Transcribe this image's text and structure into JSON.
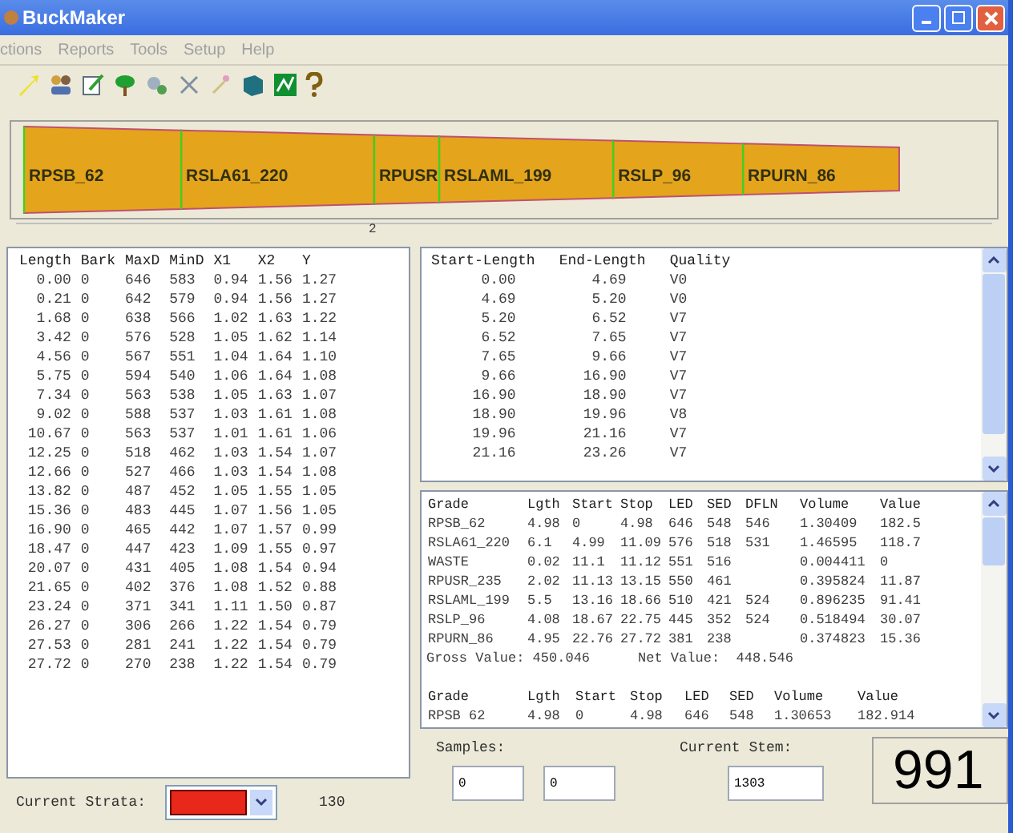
{
  "window": {
    "title": "BuckMaker"
  },
  "menu": [
    "ctions",
    "Reports",
    "Tools",
    "Setup",
    "Help"
  ],
  "log_segments": [
    {
      "label": "RPSB_62"
    },
    {
      "label": "RSLA61_220"
    },
    {
      "label": "RPUSR"
    },
    {
      "label": "RSLAML_199"
    },
    {
      "label": "RSLP_96"
    },
    {
      "label": "RPURN_86"
    }
  ],
  "scale_label": "2",
  "stem_table": {
    "columns": [
      "Length",
      "Bark",
      "MaxD",
      "MinD",
      "X1",
      "X2",
      "Y"
    ],
    "rows": [
      [
        "0.00",
        "0",
        "646",
        "583",
        "0.94",
        "1.56",
        "1.27"
      ],
      [
        "0.21",
        "0",
        "642",
        "579",
        "0.94",
        "1.56",
        "1.27"
      ],
      [
        "1.68",
        "0",
        "638",
        "566",
        "1.02",
        "1.63",
        "1.22"
      ],
      [
        "3.42",
        "0",
        "576",
        "528",
        "1.05",
        "1.62",
        "1.14"
      ],
      [
        "4.56",
        "0",
        "567",
        "551",
        "1.04",
        "1.64",
        "1.10"
      ],
      [
        "5.75",
        "0",
        "594",
        "540",
        "1.06",
        "1.64",
        "1.08"
      ],
      [
        "7.34",
        "0",
        "563",
        "538",
        "1.05",
        "1.63",
        "1.07"
      ],
      [
        "9.02",
        "0",
        "588",
        "537",
        "1.03",
        "1.61",
        "1.08"
      ],
      [
        "10.67",
        "0",
        "563",
        "537",
        "1.01",
        "1.61",
        "1.06"
      ],
      [
        "12.25",
        "0",
        "518",
        "462",
        "1.03",
        "1.54",
        "1.07"
      ],
      [
        "12.66",
        "0",
        "527",
        "466",
        "1.03",
        "1.54",
        "1.08"
      ],
      [
        "13.82",
        "0",
        "487",
        "452",
        "1.05",
        "1.55",
        "1.05"
      ],
      [
        "15.36",
        "0",
        "483",
        "445",
        "1.07",
        "1.56",
        "1.05"
      ],
      [
        "16.90",
        "0",
        "465",
        "442",
        "1.07",
        "1.57",
        "0.99"
      ],
      [
        "18.47",
        "0",
        "447",
        "423",
        "1.09",
        "1.55",
        "0.97"
      ],
      [
        "20.07",
        "0",
        "431",
        "405",
        "1.08",
        "1.54",
        "0.94"
      ],
      [
        "21.65",
        "0",
        "402",
        "376",
        "1.08",
        "1.52",
        "0.88"
      ],
      [
        "23.24",
        "0",
        "371",
        "341",
        "1.11",
        "1.50",
        "0.87"
      ],
      [
        "26.27",
        "0",
        "306",
        "266",
        "1.22",
        "1.54",
        "0.79"
      ],
      [
        "27.53",
        "0",
        "281",
        "241",
        "1.22",
        "1.54",
        "0.79"
      ],
      [
        "27.72",
        "0",
        "270",
        "238",
        "1.22",
        "1.54",
        "0.79"
      ]
    ]
  },
  "quality_table": {
    "columns": [
      "Start-Length",
      "End-Length",
      "Quality"
    ],
    "rows": [
      [
        "0.00",
        "4.69",
        "V0"
      ],
      [
        "4.69",
        "5.20",
        "V0"
      ],
      [
        "5.20",
        "6.52",
        "V7"
      ],
      [
        "6.52",
        "7.65",
        "V7"
      ],
      [
        "7.65",
        "9.66",
        "V7"
      ],
      [
        "9.66",
        "16.90",
        "V7"
      ],
      [
        "16.90",
        "18.90",
        "V7"
      ],
      [
        "18.90",
        "19.96",
        "V8"
      ],
      [
        "19.96",
        "21.16",
        "V7"
      ],
      [
        "21.16",
        "23.26",
        "V7"
      ]
    ]
  },
  "grade_table": {
    "columns": [
      "Grade",
      "Lgth",
      "Start",
      "Stop",
      "LED",
      "SED",
      "DFLN",
      "Volume",
      "Value"
    ],
    "rows": [
      [
        "RPSB_62",
        "4.98",
        "0",
        "4.98",
        "646",
        "548",
        "546",
        "1.30409",
        "182.5"
      ],
      [
        "RSLA61_220",
        "6.1",
        "4.99",
        "11.09",
        "576",
        "518",
        "531",
        "1.46595",
        "118.7"
      ],
      [
        "WASTE",
        "0.02",
        "11.1",
        "11.12",
        "551",
        "516",
        "",
        "0.004411",
        "0"
      ],
      [
        "RPUSR_235",
        "2.02",
        "11.13",
        "13.15",
        "550",
        "461",
        "",
        "0.395824",
        "11.87"
      ],
      [
        "RSLAML_199",
        "5.5",
        "13.16",
        "18.66",
        "510",
        "421",
        "524",
        "0.896235",
        "91.41"
      ],
      [
        "RSLP_96",
        "4.08",
        "18.67",
        "22.75",
        "445",
        "352",
        "524",
        "0.518494",
        "30.07"
      ],
      [
        "RPURN_86",
        "4.95",
        "22.76",
        "27.72",
        "381",
        "238",
        "",
        "0.374823",
        "15.36"
      ]
    ],
    "gross": "Gross Value: 450.046",
    "net": "Net Value:  448.546"
  },
  "grade_table_2": {
    "columns": [
      "Grade",
      "Lgth",
      "Start",
      "Stop",
      "LED",
      "SED",
      "Volume",
      "Value"
    ],
    "rows": [
      [
        "RPSB 62",
        "4.98",
        "0",
        "4.98",
        "646",
        "548",
        "1.30653",
        "182.914"
      ]
    ]
  },
  "strata": {
    "label": "Current Strata:",
    "color": "#e8281a",
    "value": "130"
  },
  "samples": {
    "label": "Samples:",
    "fields": [
      "0",
      "0"
    ]
  },
  "current_stem": {
    "label": "Current Stem:",
    "value": "1303"
  },
  "count_display": "991"
}
